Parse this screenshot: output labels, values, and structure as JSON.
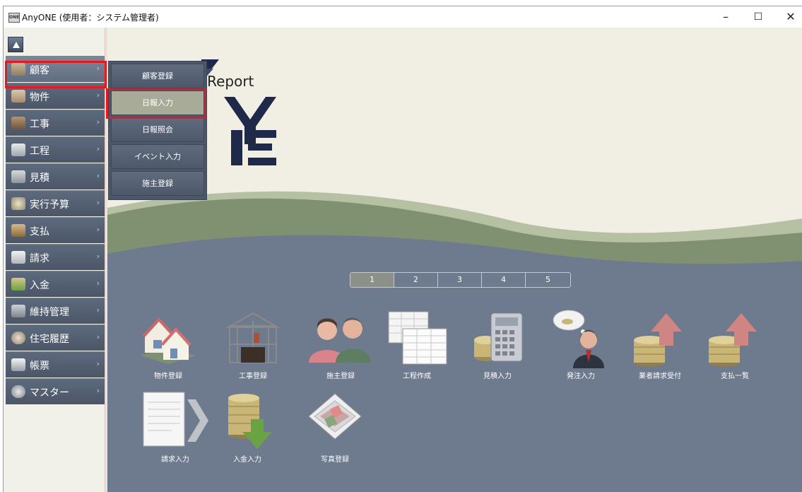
{
  "window": {
    "title": "AnyONE (使用者：システム管理者)",
    "controls": {
      "minimize": "–",
      "maximize": "☐",
      "close": "✕"
    }
  },
  "logo": {
    "fragment_top": "Z",
    "report_text": "se Report",
    "fragment_mid": "JY",
    "fragment_bottom": "NE"
  },
  "menu": {
    "items": [
      {
        "label": "顧客",
        "icon": "customer-icon",
        "active": true
      },
      {
        "label": "物件",
        "icon": "property-icon"
      },
      {
        "label": "工事",
        "icon": "construction-icon"
      },
      {
        "label": "工程",
        "icon": "process-icon"
      },
      {
        "label": "見積",
        "icon": "estimate-icon"
      },
      {
        "label": "実行予算",
        "icon": "budget-icon"
      },
      {
        "label": "支払",
        "icon": "payment-icon"
      },
      {
        "label": "請求",
        "icon": "invoice-icon"
      },
      {
        "label": "入金",
        "icon": "deposit-icon"
      },
      {
        "label": "維持管理",
        "icon": "maintenance-icon"
      },
      {
        "label": "住宅履歴",
        "icon": "housing-history-icon"
      },
      {
        "label": "帳票",
        "icon": "report-icon"
      },
      {
        "label": "マスター",
        "icon": "master-icon"
      }
    ],
    "arrow": "›"
  },
  "submenu": {
    "items": [
      {
        "label": "顧客登録"
      },
      {
        "label": "日報入力",
        "active": true
      },
      {
        "label": "日報照会"
      },
      {
        "label": "イベント入力"
      },
      {
        "label": "施主登録"
      }
    ]
  },
  "pager": {
    "pages": [
      "1",
      "2",
      "3",
      "4",
      "5"
    ],
    "current": "1"
  },
  "tiles": [
    {
      "label": "物件登録",
      "icon": "houses-icon"
    },
    {
      "label": "工事登録",
      "icon": "building-frame-icon"
    },
    {
      "label": "施主登録",
      "icon": "people-icon"
    },
    {
      "label": "工程作成",
      "icon": "spreadsheet-icon"
    },
    {
      "label": "見積入力",
      "icon": "calculator-coins-icon"
    },
    {
      "label": "発注入力",
      "icon": "businessman-coins-icon"
    },
    {
      "label": "業者請求受付",
      "icon": "coins-up-arrow-icon"
    },
    {
      "label": "支払一覧",
      "icon": "coins-up-arrow-icon"
    },
    {
      "label": "請求入力",
      "icon": "document-arrow-icon"
    },
    {
      "label": "入金入力",
      "icon": "coins-down-arrow-icon"
    },
    {
      "label": "写真登録",
      "icon": "photo-stack-icon"
    }
  ],
  "colors": {
    "highlight": "#e8181e",
    "sidebar_item": "#55606f",
    "main_panel": "#6e7a8e",
    "hill": "#7f9170",
    "accent_arrow": "#d08585",
    "down_arrow": "#6aa343"
  }
}
